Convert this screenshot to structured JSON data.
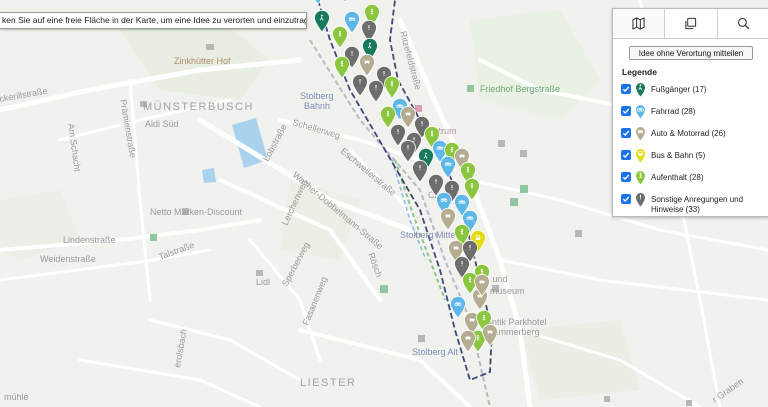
{
  "hint_text": "ken Sie auf eine freie Fläche in der Karte, um eine Idee zu verorten und einzutragen.",
  "panel": {
    "tabs": [
      {
        "icon": "map-icon",
        "active": true
      },
      {
        "icon": "copy-icon",
        "active": false
      },
      {
        "icon": "search-icon",
        "active": false
      }
    ],
    "idea_button_label": "Idee ohne Verortung mitteilen",
    "legend_title": "Legende",
    "legend_items": [
      {
        "label": "Fußgänger (17)",
        "color": "#177a5e",
        "icon": "walking-icon",
        "checked": true
      },
      {
        "label": "Fahrrad (28)",
        "color": "#5db8e8",
        "icon": "bicycle-icon",
        "checked": true
      },
      {
        "label": "Auto & Motorrad (26)",
        "color": "#b5ad92",
        "icon": "car-icon",
        "checked": true
      },
      {
        "label": "Bus & Bahn (5)",
        "color": "#e4dc12",
        "icon": "bus-icon",
        "checked": true
      },
      {
        "label": "Aufenthalt (28)",
        "color": "#8cc63e",
        "icon": "person-icon",
        "checked": true
      },
      {
        "label": "Sonstige Anregungen und Hinweise (33)",
        "color": "#6d6d6d",
        "icon": "exclamation-icon",
        "checked": true
      }
    ]
  },
  "map_labels": {
    "district_muensterbusch": "MÜNSTERBUSCH",
    "district_liester": "LIESTER",
    "zinkhuetter_hof": "Zinkhütter Hof",
    "friedhof": "Friedhof Bergstraße",
    "aldi": "Aldi Süd",
    "netto": "Netto Marken-Discount",
    "lidl": "Lidl",
    "stolberg_bahnhof_1": "Stolberg",
    "stolberg_bahnhof_2": "Bahnh",
    "zentrum": "zentrum",
    "stolberg_altstadt": "Stolberg Alt",
    "museum": "museum",
    "parkhotel": "antik Parkhotel",
    "hammerberg": "Hammerberg",
    "rotteschuhe": "el- und",
    "stolberg_mitte": "Stolberg Mitte",
    "citynear": "City",
    "streets": {
      "ritzefeld": "Ritzefeldstraße",
      "ackerill": "ckerillstraße",
      "praemien": "Prämienstraße",
      "amschacht": "Am Schacht",
      "lobstrasse": "Lobstraße",
      "schellerweg": "Schellerweg",
      "eschweiler": "Eschweilerstraße",
      "walther": "Walther-Dobbelmann-Straße",
      "lerchenweg": "Lerchenweg",
      "linden": "Lindenstraße",
      "weiden": "Weidenstraße",
      "tal": "Talstraße",
      "sperber": "Sperberweg",
      "fasanen": "Fasanenweg",
      "rosch": "Rösch",
      "brotbach": "erolsbach",
      "muehle": "mühle",
      "graben": "r Graben"
    }
  }
}
